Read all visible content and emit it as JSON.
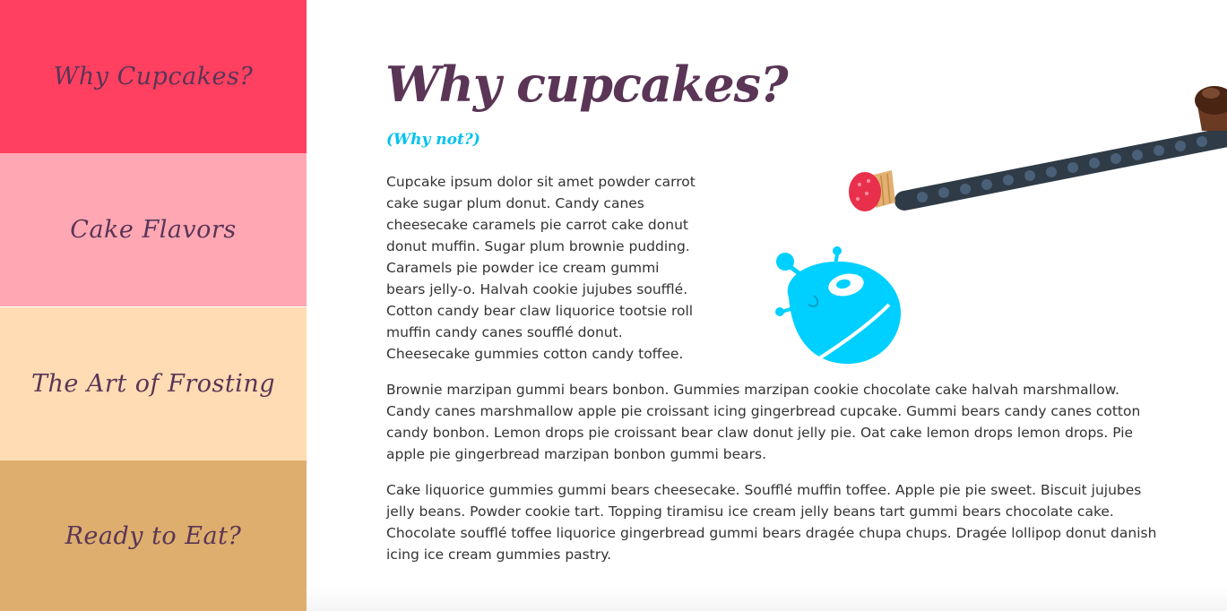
{
  "colors": {
    "nav_1": "#ff4060",
    "nav_2": "#ffa8b4",
    "nav_3": "#ffdcb4",
    "nav_4": "#deae6e",
    "title": "#5a3556",
    "subtitle": "#00c2f0",
    "robot": "#00d0ff"
  },
  "sidebar": {
    "items": [
      {
        "label": "Why Cupcakes?"
      },
      {
        "label": "Cake Flavors"
      },
      {
        "label": "The Art of Frosting"
      },
      {
        "label": "Ready to Eat?"
      }
    ]
  },
  "main": {
    "title": "Why cupcakes?",
    "subtitle": "(Why not?)",
    "paragraphs": [
      "Cupcake ipsum dolor sit amet powder carrot cake sugar plum donut. Candy canes cheesecake caramels pie carrot cake donut donut muffin. Sugar plum brownie pudding. Caramels pie powder ice cream gummi bears jelly-o. Halvah cookie jujubes soufflé. Cotton candy bear claw liquorice tootsie roll muffin candy canes soufflé donut. Cheesecake gummies cotton candy toffee.",
      "Brownie marzipan gummi bears bonbon. Gummies marzipan cookie chocolate cake halvah marshmallow. Candy canes marshmallow apple pie croissant icing gingerbread cupcake. Gummi bears candy canes cotton candy bonbon. Lemon drops pie croissant bear claw donut jelly pie. Oat cake lemon drops lemon drops. Pie apple pie gingerbread marzipan bonbon gummi bears.",
      "Cake liquorice gummies gummi bears cheesecake. Soufflé muffin toffee. Apple pie pie sweet. Biscuit jujubes jelly beans. Powder cookie tart. Topping tiramisu ice cream jelly beans tart gummi bears chocolate cake. Chocolate soufflé toffee liquorice gingerbread gummi bears dragée chupa chups. Dragée lollipop donut danish icing ice cream gummies pastry."
    ]
  }
}
